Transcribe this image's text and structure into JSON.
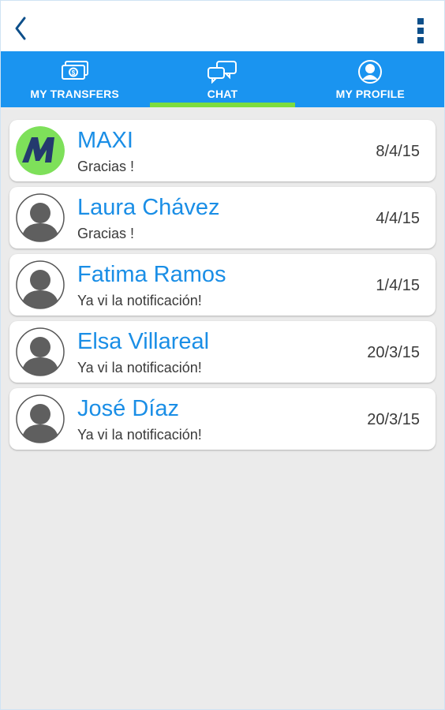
{
  "topbar": {
    "back_icon": "chevron-left-icon",
    "menu_icon": "overflow-menu-icon",
    "icon_color": "#0d4f8a"
  },
  "tabs": [
    {
      "label": "MY TRANSFERS",
      "icon": "money-transfer-icon",
      "active": false
    },
    {
      "label": "CHAT",
      "icon": "chat-bubbles-icon",
      "active": true
    },
    {
      "label": "MY PROFILE",
      "icon": "user-profile-icon",
      "active": false
    }
  ],
  "colors": {
    "tab_bar": "#1a94f0",
    "active_indicator": "#7ddc3e",
    "name_text": "#1a8ee6",
    "background": "#ebebeb"
  },
  "chats": [
    {
      "name": "MAXI",
      "last_message": "Gracias !",
      "date": "8/4/15",
      "avatar": "maxi-logo"
    },
    {
      "name": "Laura Chávez",
      "last_message": "Gracias !",
      "date": "4/4/15",
      "avatar": "default-user-avatar"
    },
    {
      "name": "Fatima Ramos",
      "last_message": "Ya vi la notificación!",
      "date": "1/4/15",
      "avatar": "default-user-avatar"
    },
    {
      "name": "Elsa Villareal",
      "last_message": "Ya vi la notificación!",
      "date": "20/3/15",
      "avatar": "default-user-avatar"
    },
    {
      "name": "José Díaz",
      "last_message": "Ya vi la notificación!",
      "date": "20/3/15",
      "avatar": "default-user-avatar"
    }
  ]
}
